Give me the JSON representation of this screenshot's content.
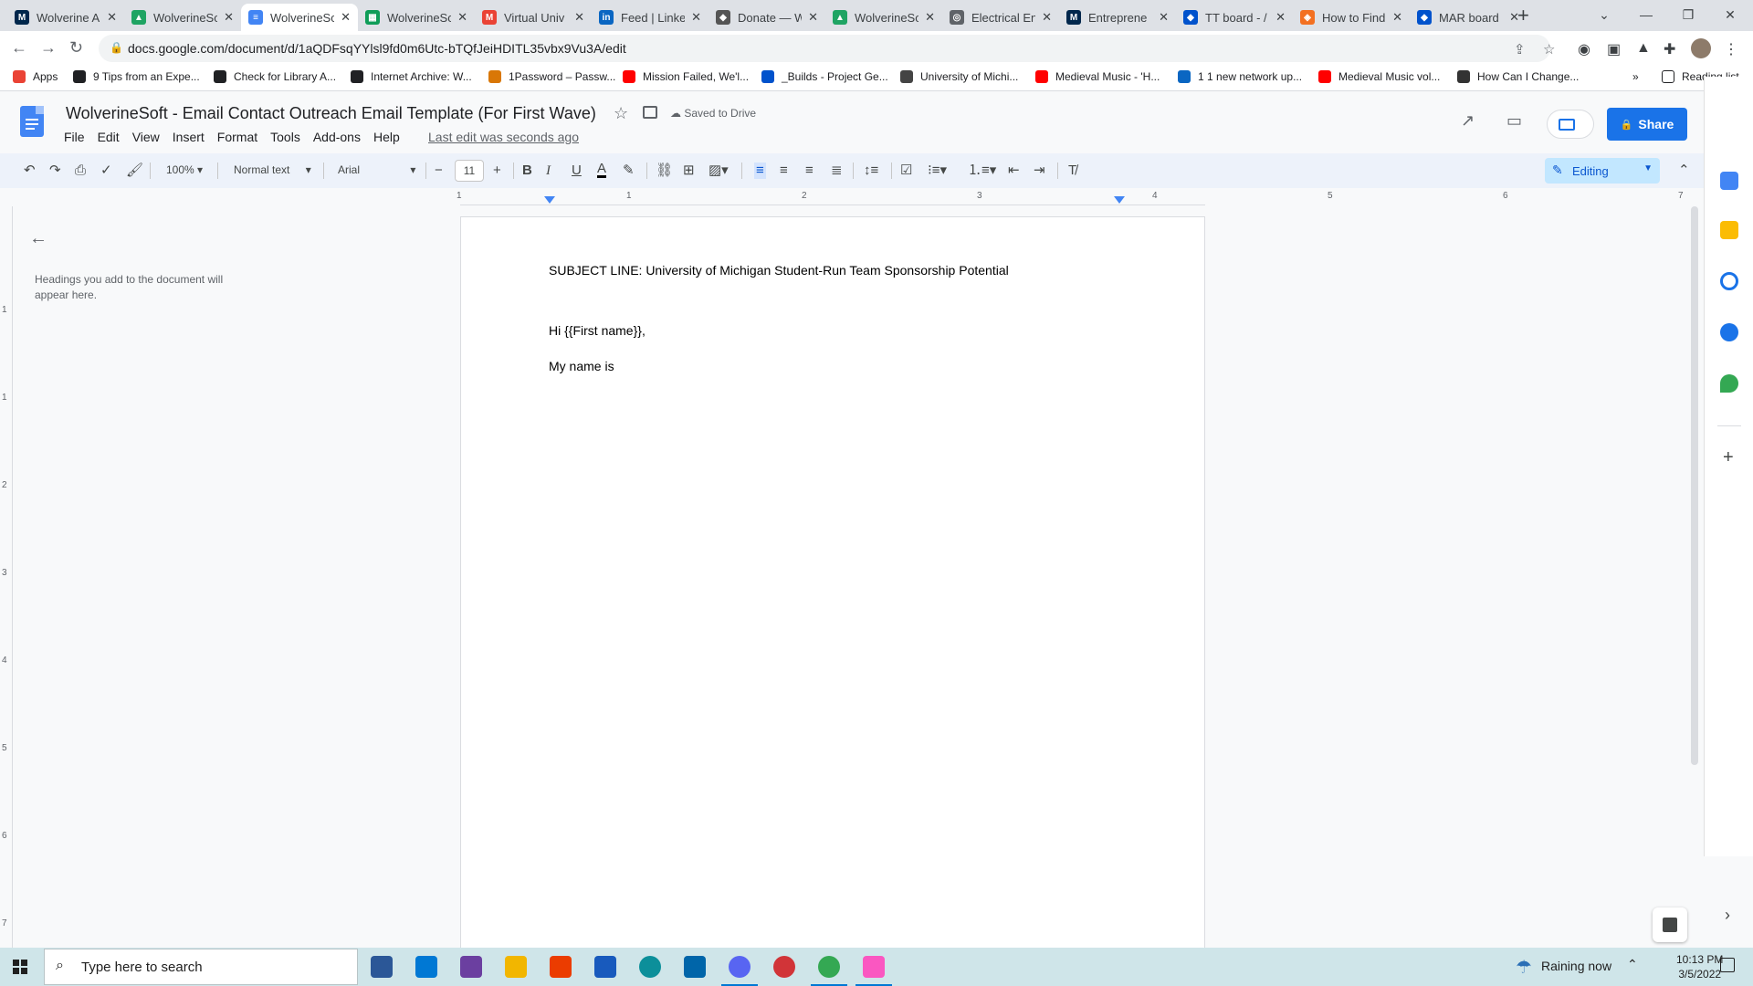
{
  "browser": {
    "tabs": [
      {
        "title": "Wolverine A",
        "color": "#00274c",
        "glyph": "M"
      },
      {
        "title": "WolverineSo",
        "color": "#1fa463",
        "glyph": "▲"
      },
      {
        "title": "WolverineSo",
        "color": "#4285f4",
        "glyph": "≡"
      },
      {
        "title": "WolverineSo",
        "color": "#0f9d58",
        "glyph": "▦"
      },
      {
        "title": "Virtual Univ",
        "color": "#ea4335",
        "glyph": "M"
      },
      {
        "title": "Feed | Linke",
        "color": "#0a66c2",
        "glyph": "in"
      },
      {
        "title": "Donate — W",
        "color": "#555555",
        "glyph": "◆"
      },
      {
        "title": "WolverineSo",
        "color": "#1fa463",
        "glyph": "▲"
      },
      {
        "title": "Electrical En",
        "color": "#5f6368",
        "glyph": "◎"
      },
      {
        "title": "Entreprene",
        "color": "#00274c",
        "glyph": "M"
      },
      {
        "title": "TT board - /",
        "color": "#0052cc",
        "glyph": "◆"
      },
      {
        "title": "How to Find",
        "color": "#f37021",
        "glyph": "◈"
      },
      {
        "title": "MAR board",
        "color": "#0052cc",
        "glyph": "◆"
      }
    ],
    "url": "docs.google.com/document/d/1aQDFsqYYlsl9fd0m6Utc-bTQfJeiHDITL35vbx9Vu3A/edit",
    "bookmarks": [
      {
        "label": "Apps",
        "color": "#ea4335"
      },
      {
        "label": "9 Tips from an Expe...",
        "color": "#202124"
      },
      {
        "label": "Check for Library A...",
        "color": "#202124"
      },
      {
        "label": "Internet Archive: W...",
        "color": "#202124"
      },
      {
        "label": "1Password – Passw...",
        "color": "#d97706"
      },
      {
        "label": "Mission Failed, We'l...",
        "color": "#ff0000"
      },
      {
        "label": "_Builds - Project Ge...",
        "color": "#0052cc"
      },
      {
        "label": "University of Michi...",
        "color": "#444444"
      },
      {
        "label": "Medieval Music - 'H...",
        "color": "#ff0000"
      },
      {
        "label": "1 1 new network up...",
        "color": "#0a66c2"
      },
      {
        "label": "Medieval Music vol...",
        "color": "#ff0000"
      },
      {
        "label": "How Can I Change...",
        "color": "#333333"
      }
    ],
    "reading_list": "Reading list"
  },
  "docs": {
    "title": "WolverineSoft - Email Contact Outreach Email Template (For First Wave)",
    "saved_status": "Saved to Drive",
    "menu": [
      "File",
      "Edit",
      "View",
      "Insert",
      "Format",
      "Tools",
      "Add-ons",
      "Help"
    ],
    "last_edit": "Last edit was seconds ago",
    "share_label": "Share",
    "toolbar": {
      "zoom": "100%",
      "style": "Normal text",
      "font": "Arial",
      "font_size": "11",
      "mode": "Editing"
    },
    "ruler_numbers": [
      "1",
      "1",
      "2",
      "3",
      "4",
      "5",
      "6",
      "7"
    ],
    "vruler_numbers": [
      "1",
      "1",
      "2",
      "3",
      "4",
      "5",
      "6",
      "7"
    ],
    "outline_hint": "Headings you add to the document will appear here.",
    "content": [
      "SUBJECT LINE: University of Michigan Student-Run Team Sponsorship Potential",
      "Hi {{First name}},",
      "My name is"
    ],
    "accent": "#1a73e8"
  },
  "taskbar": {
    "search_placeholder": "Type here to search",
    "weather": "Raining now",
    "time": "10:13 PM",
    "date": "3/5/2022",
    "apps": [
      {
        "name": "calculator-app",
        "color": "#2b5797"
      },
      {
        "name": "mail-app",
        "color": "#0078d4"
      },
      {
        "name": "podcast-app",
        "color": "#6b3fa0"
      },
      {
        "name": "file-explorer-app",
        "color": "#f2b600"
      },
      {
        "name": "office-app",
        "color": "#eb3c00"
      },
      {
        "name": "word-app",
        "color": "#185abd"
      },
      {
        "name": "edge-app",
        "color": "#0c8f9a"
      },
      {
        "name": "vscode-app",
        "color": "#0065a9"
      },
      {
        "name": "discord-app",
        "color": "#5865f2"
      },
      {
        "name": "media-app",
        "color": "#d13438"
      },
      {
        "name": "chrome-app",
        "color": "#34a853"
      },
      {
        "name": "itunes-app",
        "color": "#fa57c1"
      }
    ]
  }
}
